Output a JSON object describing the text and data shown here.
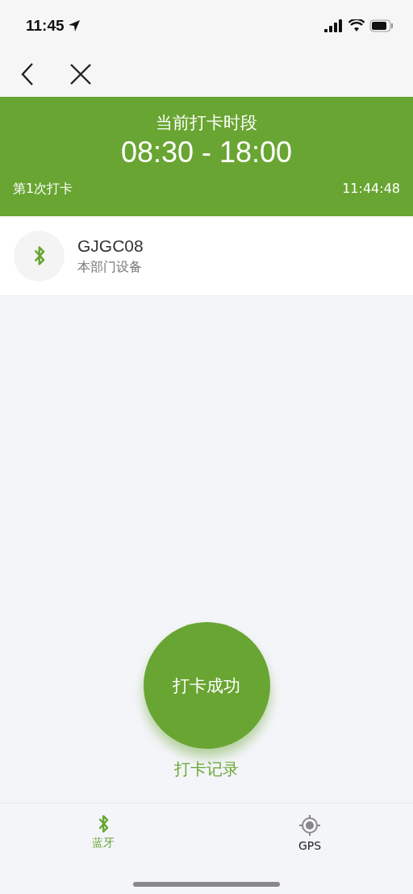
{
  "status_bar": {
    "time": "11:45"
  },
  "header": {
    "title": "当前打卡时段",
    "period": "08:30 - 18:00",
    "count_label": "第1次打卡",
    "clock": "11:44:48"
  },
  "device": {
    "name": "GJGC08",
    "description": "本部门设备"
  },
  "punch_button": {
    "label": "打卡成功"
  },
  "records_link": "打卡记录",
  "tabs": [
    {
      "kind": "bluetooth",
      "label": "蓝牙",
      "selected": true
    },
    {
      "kind": "gps",
      "label": "GPS",
      "selected": false
    }
  ]
}
